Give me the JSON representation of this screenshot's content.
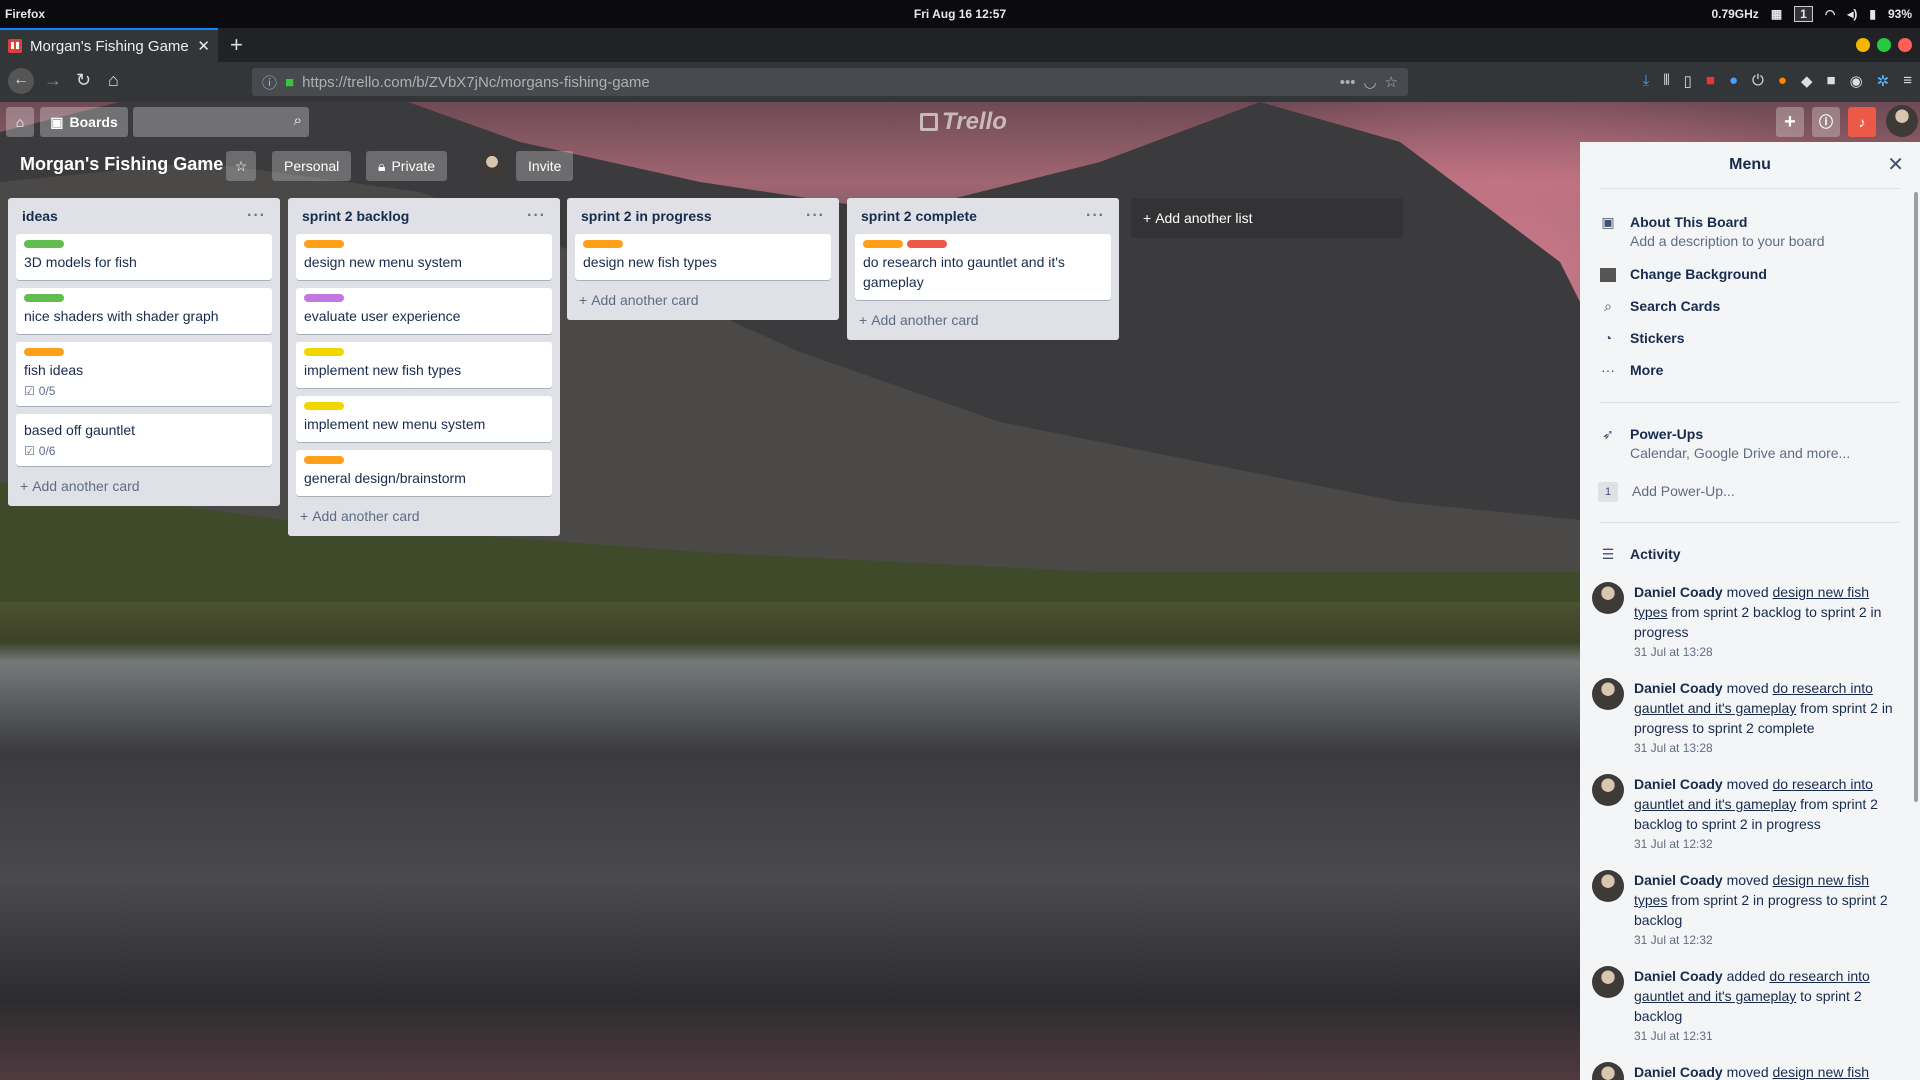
{
  "os": {
    "app": "Firefox",
    "clock": "Fri Aug 16  12:57",
    "cpu": "0.79GHz",
    "workspace": "1",
    "battery": "93%"
  },
  "browser": {
    "tab_title": "Morgan's Fishing Game",
    "url": "https://trello.com/b/ZVbX7jNc/morgans-fishing-game"
  },
  "topbar": {
    "boards_label": "Boards",
    "logo": "Trello"
  },
  "board": {
    "title": "Morgan's Fishing Game",
    "team_label": "Personal",
    "visibility_label": "Private",
    "invite_label": "Invite"
  },
  "colors": {
    "green": "#61bd4f",
    "orange": "#ff9f1a",
    "purple": "#c377e0",
    "yellow": "#f2d600",
    "red": "#eb5a46"
  },
  "lists": [
    {
      "name": "ideas",
      "add_label": "Add another card",
      "cards": [
        {
          "title": "3D models for fish",
          "labels": [
            "green"
          ]
        },
        {
          "title": "nice shaders with shader graph",
          "labels": [
            "green"
          ]
        },
        {
          "title": "fish ideas",
          "labels": [
            "orange"
          ],
          "checklist": "0/5"
        },
        {
          "title": "based off gauntlet",
          "labels": [],
          "checklist": "0/6"
        }
      ]
    },
    {
      "name": "sprint 2 backlog",
      "add_label": "Add another card",
      "cards": [
        {
          "title": "design new menu system",
          "labels": [
            "orange"
          ]
        },
        {
          "title": "evaluate user experience",
          "labels": [
            "purple"
          ]
        },
        {
          "title": "implement new fish types",
          "labels": [
            "yellow"
          ]
        },
        {
          "title": "implement new menu system",
          "labels": [
            "yellow"
          ]
        },
        {
          "title": "general design/brainstorm",
          "labels": [
            "orange"
          ]
        }
      ]
    },
    {
      "name": "sprint 2 in progress",
      "add_label": "Add another card",
      "cards": [
        {
          "title": "design new fish types",
          "labels": [
            "orange"
          ]
        }
      ]
    },
    {
      "name": "sprint 2 complete",
      "add_label": "Add another card",
      "cards": [
        {
          "title": "do research into gauntlet and it's gameplay",
          "labels": [
            "orange",
            "red"
          ]
        }
      ]
    }
  ],
  "add_list_label": "Add another list",
  "menu": {
    "title": "Menu",
    "about": {
      "title": "About This Board",
      "sub": "Add a description to your board"
    },
    "items": [
      "Change Background",
      "Search Cards",
      "Stickers",
      "More"
    ],
    "powerups": {
      "title": "Power-Ups",
      "sub": "Calendar, Google Drive and more...",
      "count": "1",
      "add": "Add Power-Up..."
    },
    "activity_title": "Activity",
    "activity": [
      {
        "user": "Daniel Coady",
        "verb": "moved",
        "link": "design new fish types",
        "rest": "from sprint 2 backlog to sprint 2 in progress",
        "time": "31 Jul at 13:28"
      },
      {
        "user": "Daniel Coady",
        "verb": "moved",
        "link": "do research into gauntlet and it's gameplay",
        "rest": "from sprint 2 in progress to sprint 2 complete",
        "time": "31 Jul at 13:28"
      },
      {
        "user": "Daniel Coady",
        "verb": "moved",
        "link": "do research into gauntlet and it's gameplay",
        "rest": "from sprint 2 backlog to sprint 2 in progress",
        "time": "31 Jul at 12:32"
      },
      {
        "user": "Daniel Coady",
        "verb": "moved",
        "link": "design new fish types",
        "rest": "from sprint 2 in progress to sprint 2 backlog",
        "time": "31 Jul at 12:32"
      },
      {
        "user": "Daniel Coady",
        "verb": "added",
        "link": "do research into gauntlet and it's gameplay",
        "rest": "to sprint 2 backlog",
        "time": "31 Jul at 12:31"
      },
      {
        "user": "Daniel Coady",
        "verb": "moved",
        "link": "design new fish types",
        "rest": "",
        "time": ""
      }
    ]
  }
}
